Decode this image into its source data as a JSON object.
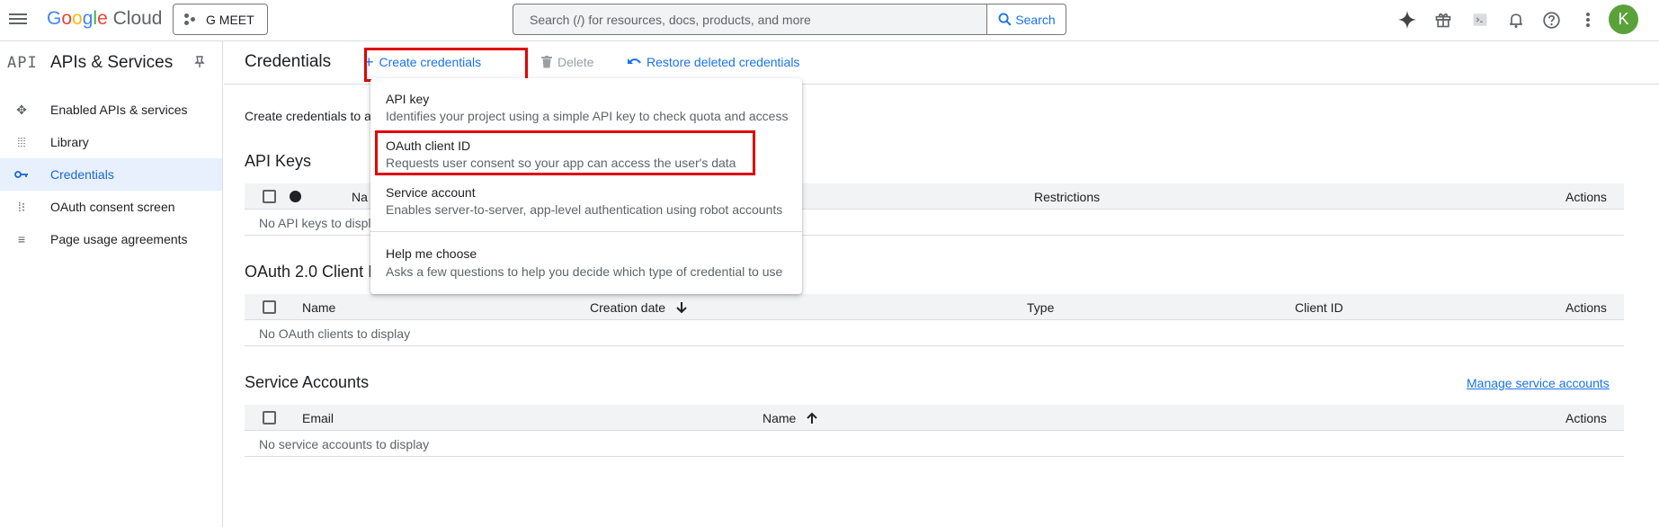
{
  "header": {
    "logo_google": "Google",
    "logo_cloud": "Cloud",
    "project": "G MEET",
    "search_placeholder": "Search (/) for resources, docs, products, and more",
    "search_button": "Search",
    "avatar_initial": "K"
  },
  "sidebar": {
    "logo": "API",
    "title": "APIs & Services",
    "items": [
      {
        "label": "Enabled APIs & services",
        "icon": "hub-icon"
      },
      {
        "label": "Library",
        "icon": "library-icon"
      },
      {
        "label": "Credentials",
        "icon": "key-icon",
        "active": true
      },
      {
        "label": "OAuth consent screen",
        "icon": "consent-icon"
      },
      {
        "label": "Page usage agreements",
        "icon": "agreements-icon"
      }
    ]
  },
  "toolbar": {
    "title": "Credentials",
    "create": "Create credentials",
    "delete": "Delete",
    "restore": "Restore deleted credentials"
  },
  "main": {
    "intro": "Create credentials to a",
    "api_keys": {
      "title": "API Keys",
      "columns": [
        "Na",
        "Restrictions",
        "Actions"
      ],
      "empty": "No API keys to displ"
    },
    "oauth": {
      "title": "OAuth 2.0 Client I",
      "columns": [
        "Name",
        "Creation date",
        "Type",
        "Client ID",
        "Actions"
      ],
      "empty": "No OAuth clients to display"
    },
    "service_accounts": {
      "title": "Service Accounts",
      "manage_link": "Manage service accounts",
      "columns": [
        "Email",
        "Name",
        "Actions"
      ],
      "empty": "No service accounts to display"
    }
  },
  "menu": {
    "items": [
      {
        "title": "API key",
        "desc": "Identifies your project using a simple API key to check quota and access"
      },
      {
        "title": "OAuth client ID",
        "desc": "Requests user consent so your app can access the user's data"
      },
      {
        "title": "Service account",
        "desc": "Enables server-to-server, app-level authentication using robot accounts"
      },
      {
        "title": "Help me choose",
        "desc": "Asks a few questions to help you decide which type of credential to use"
      }
    ]
  },
  "colors": {
    "accent": "#1a73e8",
    "highlight": "#e00000",
    "avatar": "#5ba13a"
  }
}
